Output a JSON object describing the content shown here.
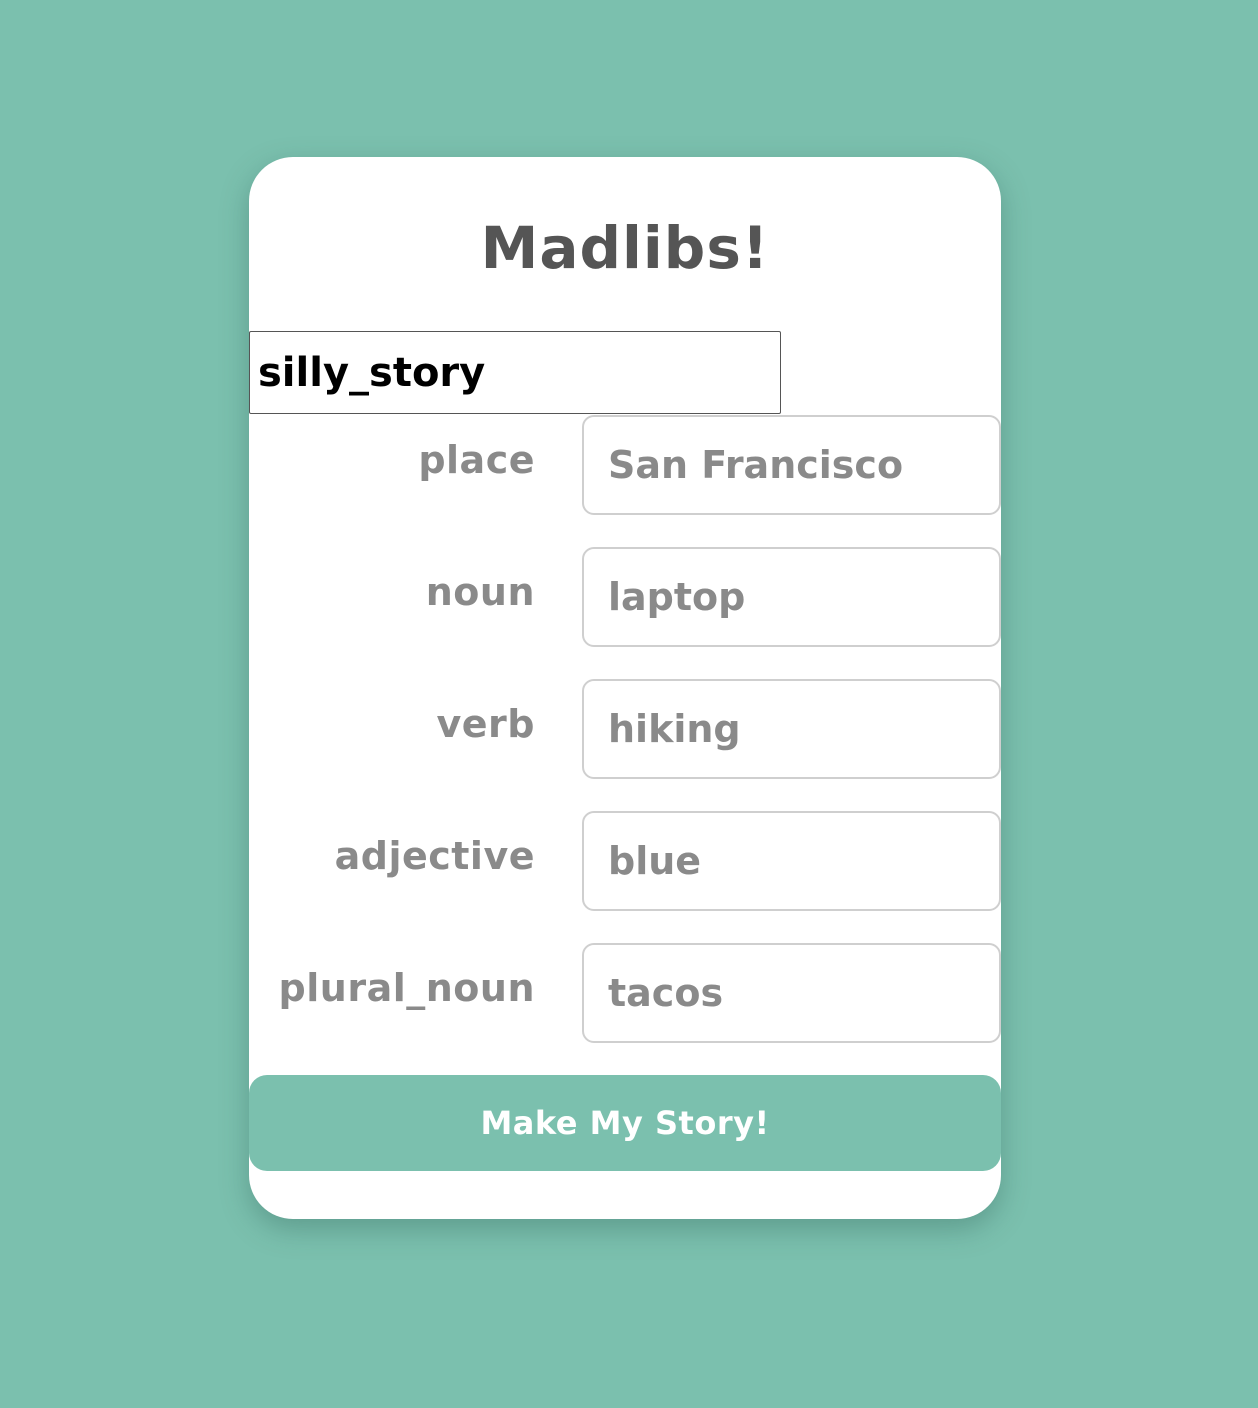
{
  "app": {
    "title": "Madlibs!"
  },
  "story_picker": {
    "selected": "silly_story"
  },
  "fields": [
    {
      "label": "place",
      "value": "San Francisco"
    },
    {
      "label": "noun",
      "value": "laptop"
    },
    {
      "label": "verb",
      "value": "hiking"
    },
    {
      "label": "adjective",
      "value": "blue"
    },
    {
      "label": "plural_noun",
      "value": "tacos"
    }
  ],
  "submit": {
    "label": "Make My Story!"
  },
  "colors": {
    "background": "#7bc0ae",
    "card": "#ffffff",
    "title_text": "#555555",
    "label_text": "#8a8a8a",
    "button_bg": "#7bc0ae",
    "button_text": "#ffffff"
  }
}
